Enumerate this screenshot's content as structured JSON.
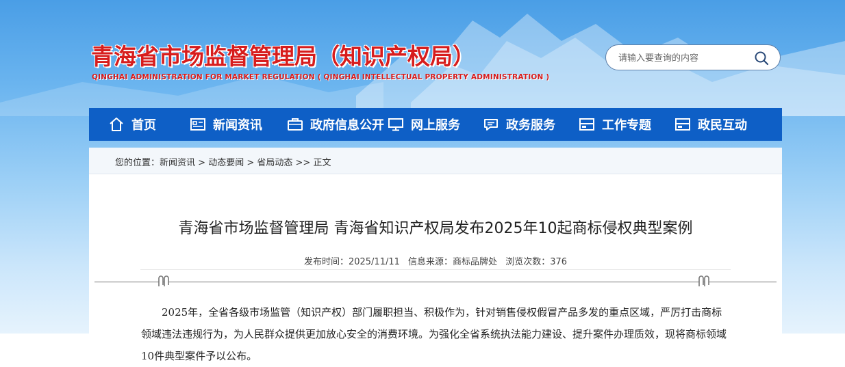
{
  "header": {
    "title": "青海省市场监督管理局（知识产权局）",
    "subtitle": "QINGHAI ADMINISTRATION FOR MARKET REGULATION ( QINGHAI INTELLECTUAL PROPERTY ADMINISTRATION )"
  },
  "search": {
    "placeholder": "请输入要查询的内容",
    "icon": "search-icon"
  },
  "nav": {
    "items": [
      {
        "label": "首页",
        "icon": "home-icon"
      },
      {
        "label": "新闻资讯",
        "icon": "news-icon"
      },
      {
        "label": "政府信息公开",
        "icon": "briefcase-icon"
      },
      {
        "label": "网上服务",
        "icon": "monitor-icon"
      },
      {
        "label": "政务服务",
        "icon": "chat-icon"
      },
      {
        "label": "工作专题",
        "icon": "layout-icon"
      },
      {
        "label": "政民互动",
        "icon": "layout-icon"
      }
    ]
  },
  "breadcrumb": {
    "prefix": "您的位置：",
    "items": [
      "新闻资讯",
      "动态要闻",
      "省局动态",
      "正文"
    ],
    "separators": [
      " > ",
      " > ",
      " >> "
    ]
  },
  "article": {
    "title": "青海省市场监督管理局 青海省知识产权局发布2025年10起商标侵权典型案例",
    "meta": {
      "date_label": "发布时间：",
      "date": "2025/11/11",
      "source_label": "信息来源：",
      "source": "商标品牌处",
      "views_label": "浏览次数：",
      "views": "376"
    },
    "paragraph": "2025年，全省各级市场监管（知识产权）部门履职担当、积极作为，针对销售侵权假冒产品多发的重点区域，严厉打击商标领域违法违规行为，为人民群众提供更加放心安全的消费环境。为强化全省系统执法能力建设、提升案件办理质效，现将商标领域10件典型案件予以公布。"
  },
  "colors": {
    "brand_red": "#d71d1d",
    "nav_blue": "#0e5fc6",
    "search_border": "#5d7fa8"
  }
}
